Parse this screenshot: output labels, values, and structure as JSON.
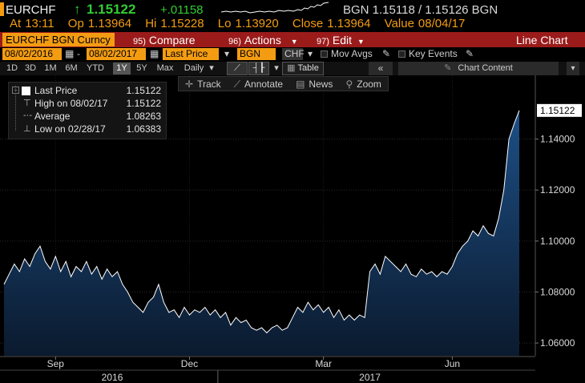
{
  "quote": {
    "ticker": "EURCHF",
    "arrow": "↑",
    "last": "1.15122",
    "change": "+.01158",
    "bid_ask": "BGN  1.15118 / 1.15126  BGN",
    "at_label": "At",
    "at_value": "13:11",
    "op_label": "Op",
    "op_value": "1.13964",
    "hi_label": "Hi",
    "hi_value": "1.15228",
    "lo_label": "Lo",
    "lo_value": "1.13920",
    "close_label": "Close",
    "close_value": "1.13964",
    "value_label": "Value",
    "value_value": "08/04/17",
    "colors": {
      "up": "#33cc33",
      "accent": "#f39c12",
      "function_bar": "#9b1b1b"
    }
  },
  "function_bar": {
    "title": "EURCHF BGN Curncy",
    "compare_num": "95)",
    "compare_label": "Compare",
    "actions_num": "96)",
    "actions_label": "Actions",
    "edit_num": "97)",
    "edit_label": "Edit",
    "view_label": "Line Chart"
  },
  "settings": {
    "start_date": "08/02/2016",
    "dash": "-",
    "end_date": "08/02/2017",
    "field": "Last Price",
    "source": "BGN",
    "currency": "CHF",
    "mov_avgs": "Mov Avgs",
    "key_events": "Key Events"
  },
  "ranges": {
    "items": [
      "1D",
      "3D",
      "1M",
      "6M",
      "YTD",
      "1Y",
      "5Y",
      "Max"
    ],
    "active": "1Y",
    "period": "Daily",
    "table_label": "Table",
    "chart_content": "Chart Content"
  },
  "tools": {
    "track": "Track",
    "annotate": "Annotate",
    "news": "News",
    "zoom": "Zoom"
  },
  "legend": {
    "last_price_label": "Last Price",
    "last_price_value": "1.15122",
    "high_label": "High on 08/02/17",
    "high_value": "1.15122",
    "average_label": "Average",
    "average_value": "1.08263",
    "low_label": "Low on 02/28/17",
    "low_value": "1.06383"
  },
  "chart_data": {
    "type": "area",
    "series_name": "Last Price",
    "ylim": [
      1.055,
      1.165
    ],
    "yticks": [
      "1.14000",
      "1.12000",
      "1.10000",
      "1.08000",
      "1.06000"
    ],
    "ytick_values": [
      1.14,
      1.12,
      1.1,
      1.08,
      1.06
    ],
    "last_label": "1.15122",
    "last_value": 1.15122,
    "month_labels": [
      "Sep",
      "Dec",
      "Mar",
      "Jun"
    ],
    "month_positions": [
      0.1,
      0.36,
      0.62,
      0.87
    ],
    "year_labels": [
      "2016",
      "2017"
    ],
    "year_positions": [
      0.21,
      0.71
    ],
    "x": [
      0,
      0.01,
      0.02,
      0.03,
      0.04,
      0.05,
      0.06,
      0.07,
      0.08,
      0.09,
      0.1,
      0.11,
      0.12,
      0.13,
      0.14,
      0.15,
      0.16,
      0.17,
      0.18,
      0.19,
      0.2,
      0.21,
      0.22,
      0.23,
      0.24,
      0.25,
      0.26,
      0.27,
      0.28,
      0.29,
      0.3,
      0.31,
      0.32,
      0.33,
      0.34,
      0.35,
      0.36,
      0.37,
      0.38,
      0.39,
      0.4,
      0.41,
      0.42,
      0.43,
      0.44,
      0.45,
      0.46,
      0.47,
      0.48,
      0.49,
      0.5,
      0.51,
      0.52,
      0.53,
      0.54,
      0.55,
      0.56,
      0.57,
      0.58,
      0.59,
      0.6,
      0.61,
      0.62,
      0.63,
      0.64,
      0.65,
      0.66,
      0.67,
      0.68,
      0.69,
      0.7,
      0.71,
      0.72,
      0.73,
      0.74,
      0.75,
      0.76,
      0.77,
      0.78,
      0.79,
      0.8,
      0.81,
      0.82,
      0.83,
      0.84,
      0.85,
      0.86,
      0.87,
      0.88,
      0.89,
      0.9,
      0.91,
      0.92,
      0.93,
      0.94,
      0.95,
      0.96,
      0.97,
      0.98,
      0.99,
      1.0
    ],
    "values": [
      1.083,
      1.087,
      1.091,
      1.088,
      1.093,
      1.09,
      1.095,
      1.098,
      1.092,
      1.089,
      1.094,
      1.088,
      1.092,
      1.086,
      1.09,
      1.088,
      1.092,
      1.087,
      1.09,
      1.085,
      1.089,
      1.086,
      1.088,
      1.083,
      1.08,
      1.076,
      1.074,
      1.072,
      1.076,
      1.078,
      1.083,
      1.076,
      1.072,
      1.073,
      1.07,
      1.074,
      1.071,
      1.073,
      1.072,
      1.074,
      1.071,
      1.073,
      1.07,
      1.072,
      1.067,
      1.07,
      1.068,
      1.069,
      1.066,
      1.065,
      1.066,
      1.064,
      1.066,
      1.067,
      1.065,
      1.066,
      1.07,
      1.074,
      1.072,
      1.076,
      1.073,
      1.075,
      1.072,
      1.074,
      1.07,
      1.073,
      1.069,
      1.071,
      1.069,
      1.071,
      1.07,
      1.088,
      1.091,
      1.087,
      1.094,
      1.092,
      1.09,
      1.088,
      1.091,
      1.087,
      1.086,
      1.089,
      1.087,
      1.088,
      1.086,
      1.088,
      1.087,
      1.09,
      1.095,
      1.098,
      1.1,
      1.104,
      1.102,
      1.106,
      1.103,
      1.102,
      1.109,
      1.12,
      1.14,
      1.146,
      1.15122
    ]
  }
}
